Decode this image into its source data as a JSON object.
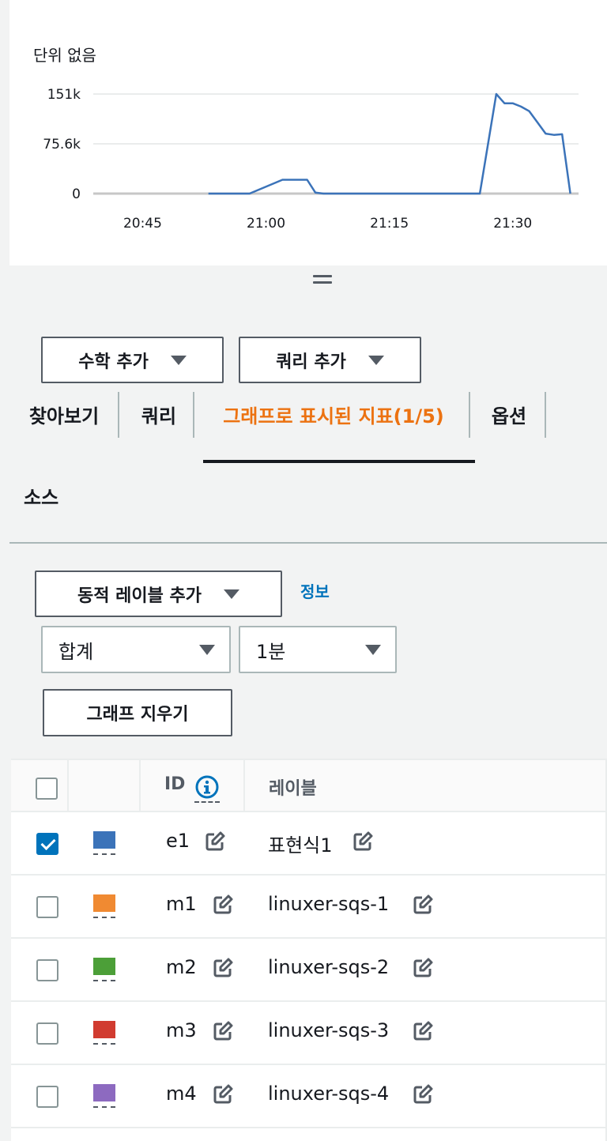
{
  "chart_data": {
    "type": "line",
    "ylabel": "단위 없음",
    "y_ticks": [
      "151k",
      "75.6k",
      "0"
    ],
    "ylim": [
      0,
      151000
    ],
    "x_ticks": [
      "20:45",
      "21:00",
      "21:15",
      "21:30"
    ],
    "series": [
      {
        "color": "#3b73b9",
        "points": [
          [
            "20:53",
            0
          ],
          [
            "20:58",
            0
          ],
          [
            "21:02",
            21000
          ],
          [
            "21:05",
            21000
          ],
          [
            "21:06",
            1500
          ],
          [
            "21:07",
            0
          ],
          [
            "21:26",
            0
          ],
          [
            "21:28",
            151000
          ],
          [
            "21:29",
            137000
          ],
          [
            "21:30",
            137000
          ],
          [
            "21:31",
            132000
          ],
          [
            "21:32",
            125000
          ],
          [
            "21:33",
            108000
          ],
          [
            "21:34",
            91000
          ],
          [
            "21:35",
            89000
          ],
          [
            "21:36",
            90000
          ],
          [
            "21:37",
            0
          ]
        ]
      }
    ]
  },
  "toolbar": {
    "add_math": "수학 추가",
    "add_query": "쿼리 추가"
  },
  "tabs": {
    "browse": "찾아보기",
    "query": "쿼리",
    "graphed_metrics": "그래프로 표시된 지표(1/5)",
    "options": "옵션",
    "source": "소스"
  },
  "controls": {
    "add_dynamic_label": "동적 레이블 추가",
    "info_link": "정보",
    "statistic": "합계",
    "period": "1분",
    "clear_graph": "그래프 지우기"
  },
  "table": {
    "columns": {
      "id": "ID",
      "label": "레이블"
    },
    "rows": [
      {
        "id": "e1",
        "label": "표현식1",
        "color": "#3b73b9",
        "checked": true
      },
      {
        "id": "m1",
        "label": "linuxer-sqs-1",
        "color": "#f08a32",
        "checked": false
      },
      {
        "id": "m2",
        "label": "linuxer-sqs-2",
        "color": "#4c9f38",
        "checked": false
      },
      {
        "id": "m3",
        "label": "linuxer-sqs-3",
        "color": "#d13b30",
        "checked": false
      },
      {
        "id": "m4",
        "label": "linuxer-sqs-4",
        "color": "#8d6ac0",
        "checked": false
      }
    ]
  }
}
